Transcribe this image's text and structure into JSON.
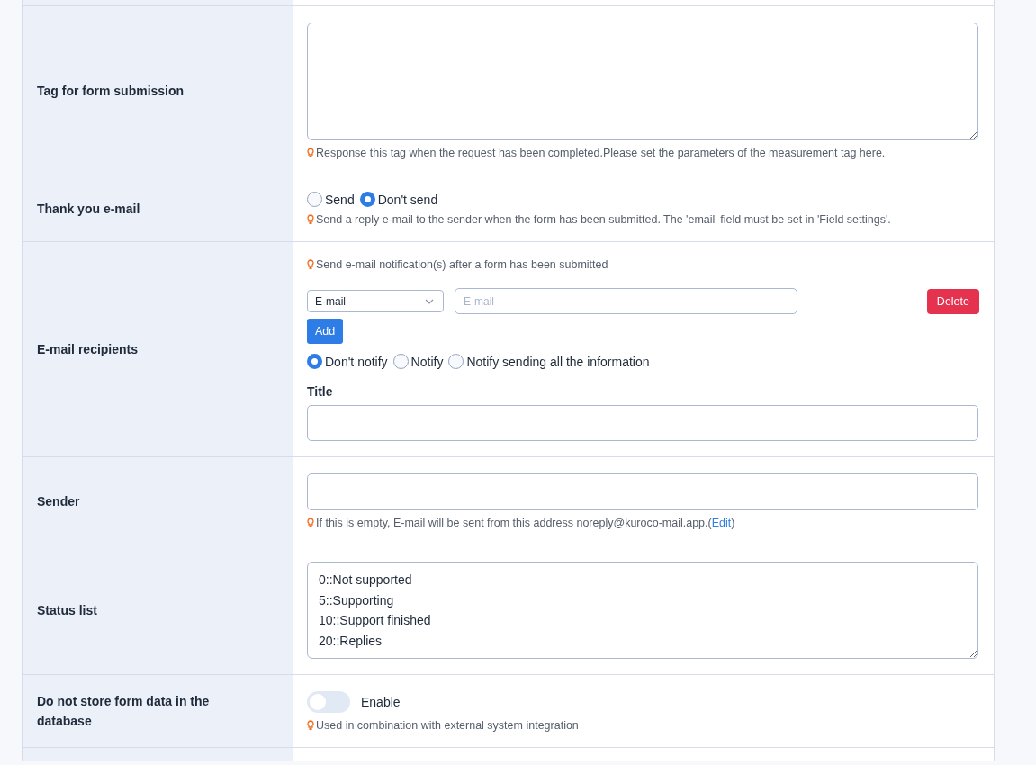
{
  "rows": [
    {
      "kind": "textarea",
      "label": "Tag for form submission",
      "value_lines": [],
      "hint": "Response this tag when the request has been completed.Please set the parameters of the measurement tag here."
    },
    {
      "kind": "radio",
      "label": "Thank you e-mail",
      "options": [
        {
          "label": "Send",
          "selected": false
        },
        {
          "label": "Don't send",
          "selected": true
        }
      ],
      "hint": "Send a reply e-mail to the sender when the form has been submitted. The 'email' field must be set in 'Field settings'."
    },
    {
      "kind": "recipients",
      "label": "E-mail recipients",
      "hint": "Send e-mail notification(s) after a form has been submitted",
      "select_value": "E-mail",
      "email_placeholder": "E-mail",
      "delete_button": "Delete",
      "add_button": "Add",
      "options": [
        {
          "label": "Don't notify",
          "selected": true
        },
        {
          "label": "Notify",
          "selected": false
        },
        {
          "label": "Notify sending all the information",
          "selected": false
        }
      ],
      "title_label": "Title"
    },
    {
      "kind": "sender",
      "label": "Sender",
      "hint_prefix": "If this is empty, E-mail will be sent from this address noreply@kuroco-mail.app.(",
      "hint_link": "Edit",
      "hint_suffix": ")"
    },
    {
      "kind": "textarea",
      "label": "Status list",
      "value_lines": [
        "0::Not supported",
        "5::Supporting",
        "10::Support finished",
        "20::Replies"
      ]
    },
    {
      "kind": "toggle",
      "label": "Do not store form data in the database",
      "on": false,
      "toggle_label": "Enable",
      "hint": "Used in combination with external system integration"
    }
  ]
}
